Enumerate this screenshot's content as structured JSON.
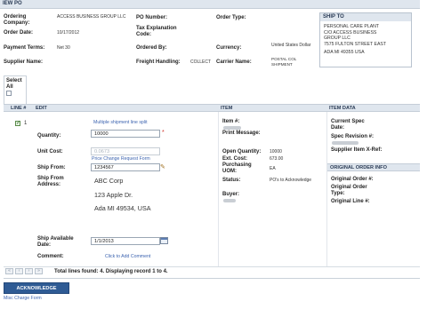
{
  "header": {
    "title": "IEW PO"
  },
  "order": {
    "company_label": "Ordering Company:",
    "company_value": "ACCESS BUSINESS GROUP LLC",
    "po_label": "PO Number:",
    "po_value": "",
    "type_label": "Order Type:",
    "type_value": "",
    "date_label": "Order Date:",
    "date_value": "10/17/2012",
    "tax_label": "Tax Explanation Code:",
    "tax_value": "",
    "terms_label": "Payment Terms:",
    "terms_value": "Net 30",
    "ordered_by_label": "Ordered By:",
    "ordered_by_value": "",
    "currency_label": "Currency:",
    "currency_value": "United States Dollar",
    "supplier_label": "Supplier Name:",
    "supplier_value": "",
    "freight_label": "Freight Handling:",
    "freight_value": "COLLECT",
    "carrier_label": "Carrier Name:",
    "carrier_value": "POSTAL COL SHIPMENT"
  },
  "ship_to": {
    "title": "SHIP TO",
    "lines": [
      "PERSONAL CARE PLANT",
      "C/O ACCESS BUSINESS",
      "GROUP LLC",
      "7575 FULTON STREET EAST",
      "ADA MI 49355 USA"
    ]
  },
  "select_all": {
    "label": "Select All"
  },
  "grid": {
    "headers": {
      "line": "LINE #",
      "edit": "EDIT",
      "item": "ITEM",
      "item_data": "ITEM DATA"
    },
    "row": {
      "line_number": "1",
      "multi_ship_link": "Multiple shipment line split",
      "quantity_label": "Quantity:",
      "quantity_value": "10000",
      "required_mark": "*",
      "unit_cost_label": "Unit Cost:",
      "unit_cost_value": "0.0673",
      "price_change_link": "Price Change Request Form",
      "ship_from_label": "Ship From:",
      "ship_from_value": "1234567",
      "ship_from_address_label": "Ship From Address:",
      "address_lines": [
        "ABC Corp",
        "123 Apple Dr.",
        "Ada MI 49534, USA"
      ],
      "ship_available_label": "Ship Available Date:",
      "ship_available_value": "1/1/2013",
      "comment_label": "Comment:",
      "add_comment_link": "Click to Add Comment",
      "item_label": "Item #:",
      "print_message_label": "Print Message:",
      "open_qty_label": "Open Quantity:",
      "open_qty_value": "10000",
      "ext_cost_label": "Ext. Cost:",
      "ext_cost_value": "673.00",
      "uom_label": "Purchasing UOM:",
      "uom_value": "EA",
      "status_label": "Status:",
      "status_value": "PO's to Acknowledge",
      "buyer_label": "Buyer:",
      "current_spec_label": "Current Spec Date:",
      "spec_revision_label": "Spec Revision #:",
      "supplier_item_label": "Supplier Item X-Ref:",
      "original_order_info_title": "ORIGINAL ORDER INFO",
      "original_order_label": "Original Order #:",
      "original_order_type_label": "Original Order Type:",
      "original_line_label": "Original Line #:"
    }
  },
  "pager": {
    "first": "«",
    "prev": "‹",
    "next": "›",
    "last": "»",
    "summary": "Total lines found: 4. Displaying record 1 to 4."
  },
  "actions": {
    "acknowledge_label": "ACKNOWLEDGE",
    "misc_charge_link": "Misc Charge Form"
  },
  "colors": {
    "header_bg": "#dfe6ee",
    "primary_button": "#2f5b94",
    "link": "#3d64b0",
    "required": "#d0332b"
  }
}
